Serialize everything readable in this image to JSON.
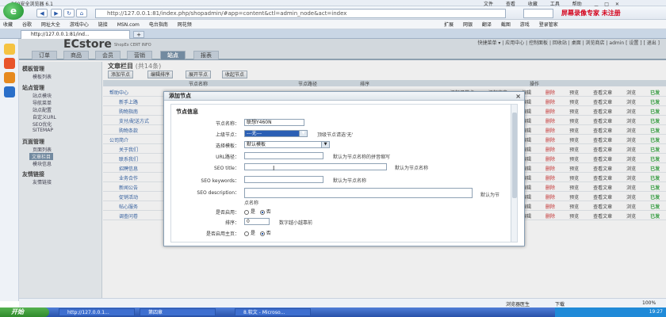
{
  "browser": {
    "title": "360安全浏览器 6.1",
    "menu": [
      "文件",
      "查看",
      "收藏",
      "工具",
      "帮助"
    ],
    "url": "http://127.0.0.1:81/index.php/shopadmin/#app=content&ctl=admin_node&act=index",
    "recorder_text": "屏幕录像专家 未注册",
    "favorites": [
      "收藏",
      "谷歌",
      "网址大全",
      "游戏中心",
      "链接",
      "MSN.com",
      "电台指南",
      "网花频"
    ],
    "fav_right": [
      "扩展",
      "网银",
      "翻译",
      "截图",
      "游戏",
      "登录管家"
    ],
    "tab_title": "http://127.0.0.1:81/ind...",
    "tab_add": "+"
  },
  "ecstore": {
    "logo": "ECstore",
    "subtitle": "ShopEx CERT INFO",
    "toplinks": "快捷菜单 ▾ | 应用中心 | 控制面板 | 回收站 | 桌面 | 浏览商店 | admin [ 设置 ] [ 退出 ]",
    "tabs": [
      "订单",
      "商品",
      "会员",
      "营销",
      "站点",
      "报表"
    ],
    "active_tab": 4
  },
  "sidebar": {
    "groups": [
      {
        "title": "模板管理",
        "items": [
          "模板列表"
        ]
      },
      {
        "title": "站点管理",
        "items": [
          "站点模块",
          "导航菜单",
          "站点配置",
          "自定义URL",
          "SEO优化",
          "SITEMAP"
        ]
      },
      {
        "title": "页面管理",
        "items": [
          "页面列表",
          "文章栏目",
          "模块信息"
        ]
      },
      {
        "title": "友情链接",
        "items": [
          "友情链接"
        ]
      }
    ],
    "selected": "文章栏目"
  },
  "content": {
    "heading": "文章栏目",
    "count": "(共14条)",
    "toolbar": [
      "添加节点",
      "编辑排序",
      "展开节点",
      "收起节点"
    ],
    "columns": [
      "节点名称",
      "节点路径",
      "排序",
      "操作"
    ],
    "rows": [
      "帮助中心",
      "新手上路",
      "购物指南",
      "支付/配送方式",
      "购物条款",
      "公司简介",
      "关于我们",
      "联系我们",
      "招聘信息",
      "业务合作",
      "新闻公告",
      "促销活动",
      "帖心服务",
      "调查问卷"
    ],
    "actions": [
      "添加子节点",
      "添加文章",
      "编辑",
      "删除",
      "预览",
      "查看文章",
      "浏览",
      "已发"
    ]
  },
  "dialog": {
    "title": "添加节点",
    "section": "节点信息",
    "fields": {
      "name_label": "节点名称：",
      "name_value": "联想Y460N",
      "parent_label": "上级节点：",
      "parent_value": "---无---",
      "parent_hint": "顶级节点请选'无'",
      "template_label": "选择模板：",
      "template_value": "默认模板",
      "url_label": "URL路径：",
      "url_hint": "默认为节点名称的拼音缩写",
      "seo_title_label": "SEO title：",
      "seo_title_hint": "默认为节点名称",
      "seo_keywords_label": "SEO keywords：",
      "seo_keywords_hint": "默认为节点名称",
      "seo_desc_label": "SEO description：",
      "seo_desc_hint1": "默认为节",
      "seo_desc_hint2": "点名称",
      "enabled_label": "是否启用：",
      "yes": "是",
      "no": "否",
      "order_label": "排序：",
      "order_value": "0",
      "order_hint": "数字越小越靠前",
      "homepage_label": "是否启用主页："
    },
    "close": "×"
  },
  "status": {
    "left": "浏览器医生",
    "download": "下载",
    "zoom": "100%"
  },
  "taskbar": {
    "start": "开始",
    "tasks": [
      "http://127.0.0.1...",
      "第四章",
      "8.软文 - Microso..."
    ],
    "clock": "19:27"
  }
}
